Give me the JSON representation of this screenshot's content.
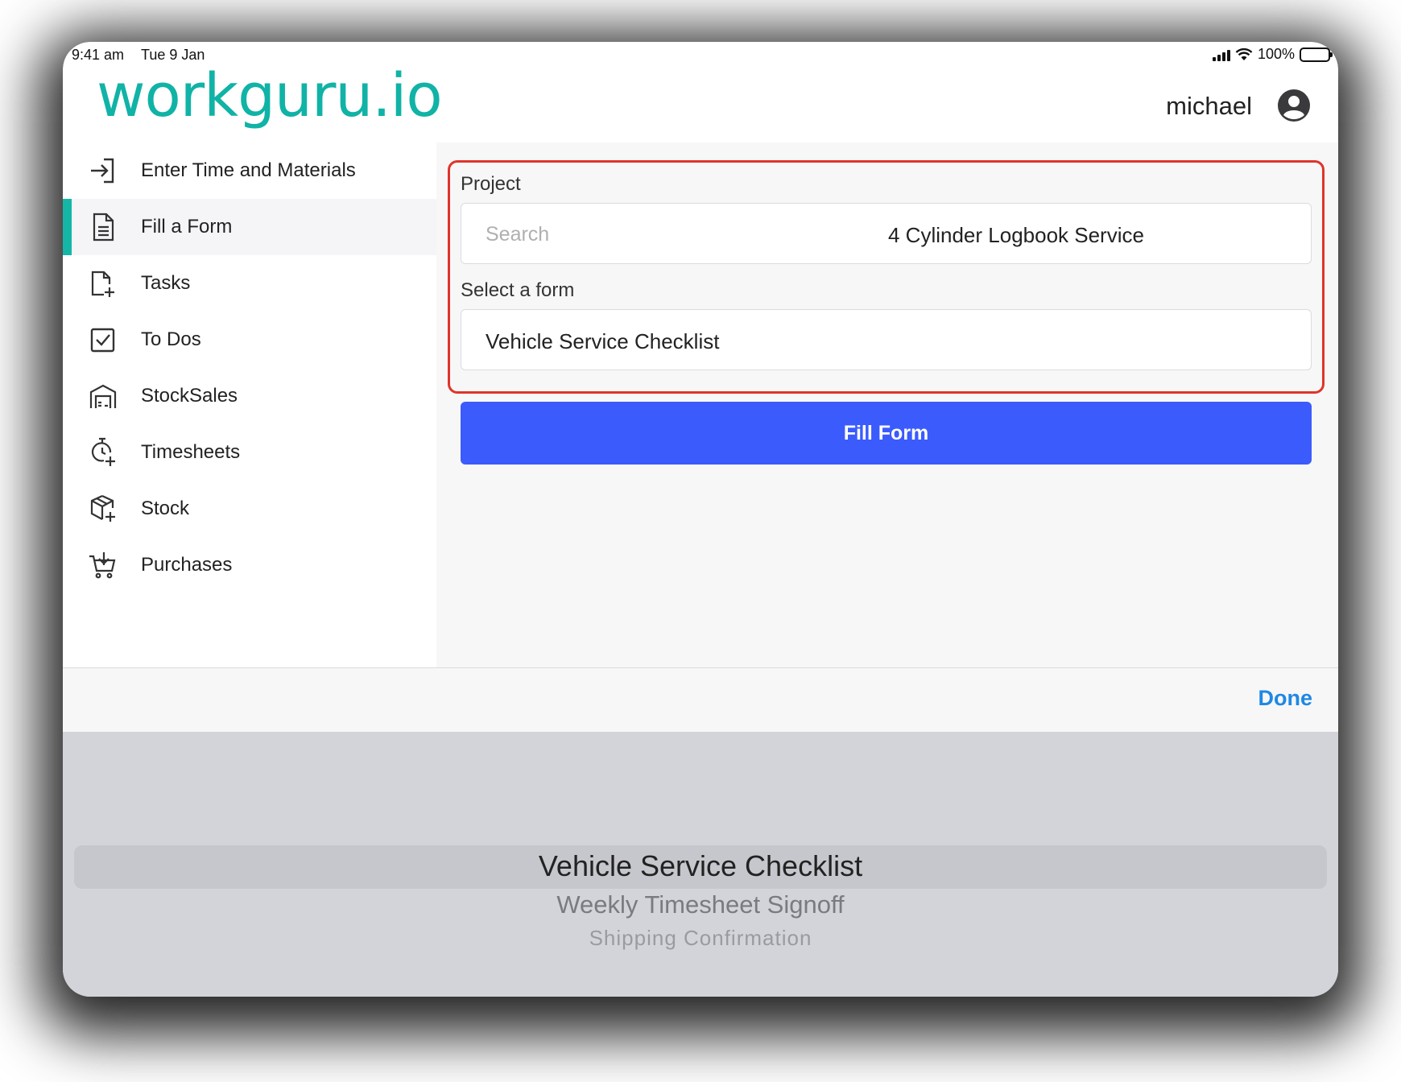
{
  "status_bar": {
    "time": "9:41 am",
    "date": "Tue 9 Jan",
    "battery": "100%"
  },
  "header": {
    "logo": "workguru.io",
    "username": "michael"
  },
  "sidebar": {
    "items": [
      {
        "label": "Enter Time and Materials",
        "icon": "sign-in-icon"
      },
      {
        "label": "Fill a Form",
        "icon": "document-icon",
        "active": true
      },
      {
        "label": "Tasks",
        "icon": "task-add-icon"
      },
      {
        "label": "To Dos",
        "icon": "checkbox-icon"
      },
      {
        "label": "StockSales",
        "icon": "warehouse-icon"
      },
      {
        "label": "Timesheets",
        "icon": "stopwatch-icon"
      },
      {
        "label": "Stock",
        "icon": "box-icon"
      },
      {
        "label": "Purchases",
        "icon": "cart-icon"
      }
    ]
  },
  "main": {
    "project_label": "Project",
    "search_placeholder": "Search",
    "project_value": "4 Cylinder Logbook Service",
    "form_label": "Select a form",
    "form_value": "Vehicle Service Checklist",
    "fill_button": "Fill Form"
  },
  "picker": {
    "done_label": "Done",
    "options": [
      "Vehicle Service Checklist",
      "Weekly Timesheet Signoff",
      "Shipping Confirmation"
    ]
  },
  "colors": {
    "brand": "#10b3a6",
    "accent_button": "#3b5bfd",
    "highlight_border": "#e0342b",
    "done_link": "#1e88e5"
  }
}
